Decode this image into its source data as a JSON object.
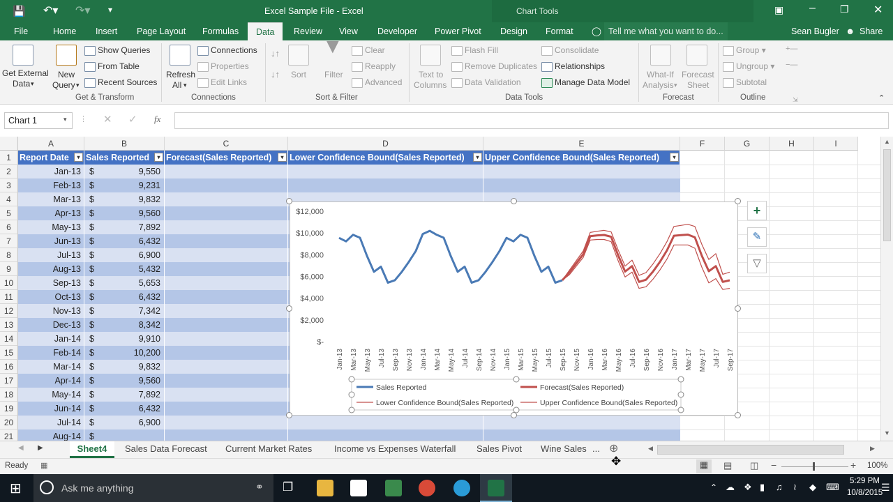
{
  "window": {
    "title": "Excel Sample File - Excel",
    "context_title": "Chart Tools"
  },
  "menu": {
    "tabs": [
      "File",
      "Home",
      "Insert",
      "Page Layout",
      "Formulas",
      "Data",
      "Review",
      "View",
      "Developer",
      "Power Pivot",
      "Design",
      "Format"
    ],
    "active": "Data",
    "tell_me": "Tell me what you want to do...",
    "user": "Sean Bugler",
    "share": "Share"
  },
  "ribbon": {
    "get_external_1": "Get External",
    "get_external_2": "Data",
    "new_query_1": "New",
    "new_query_2": "Query",
    "show_queries": "Show Queries",
    "from_table": "From Table",
    "recent_sources": "Recent Sources",
    "group_get_transform": "Get & Transform",
    "refresh_1": "Refresh",
    "refresh_2": "All",
    "connections": "Connections",
    "properties": "Properties",
    "edit_links": "Edit Links",
    "group_connections": "Connections",
    "sort": "Sort",
    "filter": "Filter",
    "clear": "Clear",
    "reapply": "Reapply",
    "advanced": "Advanced",
    "group_sort_filter": "Sort & Filter",
    "text_to_columns_1": "Text to",
    "text_to_columns_2": "Columns",
    "flash_fill": "Flash Fill",
    "remove_duplicates": "Remove Duplicates",
    "data_validation": "Data Validation",
    "consolidate": "Consolidate",
    "relationships": "Relationships",
    "manage_data_model": "Manage Data Model",
    "group_data_tools": "Data Tools",
    "what_if_1": "What-If",
    "what_if_2": "Analysis",
    "forecast_sheet_1": "Forecast",
    "forecast_sheet_2": "Sheet",
    "group_forecast": "Forecast",
    "group": "Group",
    "ungroup": "Ungroup",
    "subtotal": "Subtotal",
    "group_outline": "Outline"
  },
  "formula_bar": {
    "name_box": "Chart 1",
    "formula": ""
  },
  "columns": [
    "A",
    "B",
    "C",
    "D",
    "E",
    "F",
    "G",
    "H",
    "I"
  ],
  "table_headers": [
    "Report Date",
    "Sales Reported",
    "Forecast(Sales Reported)",
    "Lower Confidence Bound(Sales Reported)",
    "Upper Confidence Bound(Sales Reported)"
  ],
  "rows": [
    {
      "n": "1"
    },
    {
      "n": "2",
      "date": "Jan-13",
      "cur": "$",
      "val": "9,550"
    },
    {
      "n": "3",
      "date": "Feb-13",
      "cur": "$",
      "val": "9,231"
    },
    {
      "n": "4",
      "date": "Mar-13",
      "cur": "$",
      "val": "9,832"
    },
    {
      "n": "5",
      "date": "Apr-13",
      "cur": "$",
      "val": "9,560"
    },
    {
      "n": "6",
      "date": "May-13",
      "cur": "$",
      "val": "7,892"
    },
    {
      "n": "7",
      "date": "Jun-13",
      "cur": "$",
      "val": "6,432"
    },
    {
      "n": "8",
      "date": "Jul-13",
      "cur": "$",
      "val": "6,900"
    },
    {
      "n": "9",
      "date": "Aug-13",
      "cur": "$",
      "val": "5,432"
    },
    {
      "n": "10",
      "date": "Sep-13",
      "cur": "$",
      "val": "5,653"
    },
    {
      "n": "11",
      "date": "Oct-13",
      "cur": "$",
      "val": "6,432"
    },
    {
      "n": "12",
      "date": "Nov-13",
      "cur": "$",
      "val": "7,342"
    },
    {
      "n": "13",
      "date": "Dec-13",
      "cur": "$",
      "val": "8,342"
    },
    {
      "n": "14",
      "date": "Jan-14",
      "cur": "$",
      "val": "9,910"
    },
    {
      "n": "15",
      "date": "Feb-14",
      "cur": "$",
      "val": "10,200"
    },
    {
      "n": "16",
      "date": "Mar-14",
      "cur": "$",
      "val": "9,832"
    },
    {
      "n": "17",
      "date": "Apr-14",
      "cur": "$",
      "val": "9,560"
    },
    {
      "n": "18",
      "date": "May-14",
      "cur": "$",
      "val": "7,892"
    },
    {
      "n": "19",
      "date": "Jun-14",
      "cur": "$",
      "val": "6,432"
    },
    {
      "n": "20",
      "date": "Jul-14",
      "cur": "$",
      "val": "6,900"
    },
    {
      "n": "21",
      "date": "Aug-14",
      "cur": "$",
      "val": ""
    }
  ],
  "chart_data": {
    "type": "line",
    "title": "",
    "y_ticks": [
      "$12,000",
      "$10,000",
      "$8,000",
      "$6,000",
      "$4,000",
      "$2,000",
      "$-"
    ],
    "ylim": [
      0,
      12000
    ],
    "x_tick_labels": [
      "Jan-13",
      "Mar-13",
      "May-13",
      "Jul-13",
      "Sep-13",
      "Nov-13",
      "Jan-14",
      "Mar-14",
      "May-14",
      "Jul-14",
      "Sep-14",
      "Nov-14",
      "Jan-15",
      "Mar-15",
      "May-15",
      "Jul-15",
      "Sep-15",
      "Nov-15",
      "Jan-16",
      "Mar-16",
      "May-16",
      "Jul-16",
      "Sep-16",
      "Nov-16",
      "Jan-17",
      "Mar-17",
      "May-17",
      "Jul-17",
      "Sep-17"
    ],
    "series": [
      {
        "name": "Sales Reported",
        "color": "#4a7ab5",
        "start": 0,
        "values": [
          9550,
          9231,
          9832,
          9560,
          7892,
          6432,
          6900,
          5432,
          5653,
          6432,
          7342,
          8342,
          9910,
          10200,
          9832,
          9560,
          7892,
          6432,
          6900,
          5432,
          5653,
          6432,
          7342,
          8342,
          9550,
          9231,
          9832,
          9560,
          7892,
          6432,
          6900,
          5432,
          5653
        ]
      },
      {
        "name": "Forecast(Sales Reported)",
        "color": "#c0504d",
        "start": 32,
        "values": [
          5653,
          6350,
          7200,
          8050,
          9700,
          9780,
          9820,
          9650,
          7950,
          6450,
          6950,
          5500,
          5700,
          6450,
          7350,
          8400,
          9750,
          9800,
          9850,
          9600,
          7900,
          6480,
          6950,
          5500,
          5650
        ]
      },
      {
        "name": "Lower Confidence Bound(Sales Reported)",
        "color": "#c0504d",
        "start": 32,
        "values": [
          5653,
          6150,
          6950,
          7750,
          9350,
          9400,
          9400,
          9200,
          7450,
          5950,
          6400,
          4900,
          5050,
          5750,
          6600,
          7600,
          8900,
          8900,
          8900,
          8600,
          6850,
          5400,
          5800,
          4800,
          4900
        ]
      },
      {
        "name": "Upper Confidence Bound(Sales Reported)",
        "color": "#c0504d",
        "start": 32,
        "values": [
          5653,
          6550,
          7450,
          8350,
          10050,
          10160,
          10240,
          10100,
          8450,
          6950,
          7500,
          6100,
          6350,
          7150,
          8100,
          9200,
          10600,
          10700,
          10800,
          10600,
          8950,
          7560,
          8100,
          6200,
          6400
        ]
      }
    ],
    "legend": "bottom"
  },
  "sheets": [
    "Sheet4",
    "Sales Data Forecast",
    "Current Market Rates",
    "Income vs Expenses Waterfall",
    "Sales Pivot",
    "Wine Sales"
  ],
  "active_sheet": "Sheet4",
  "sheets_more": "...",
  "status": {
    "ready": "Ready",
    "zoom": "100%"
  },
  "taskbar": {
    "search": "Ask me anything",
    "time": "5:29 PM",
    "date": "10/8/2015"
  }
}
